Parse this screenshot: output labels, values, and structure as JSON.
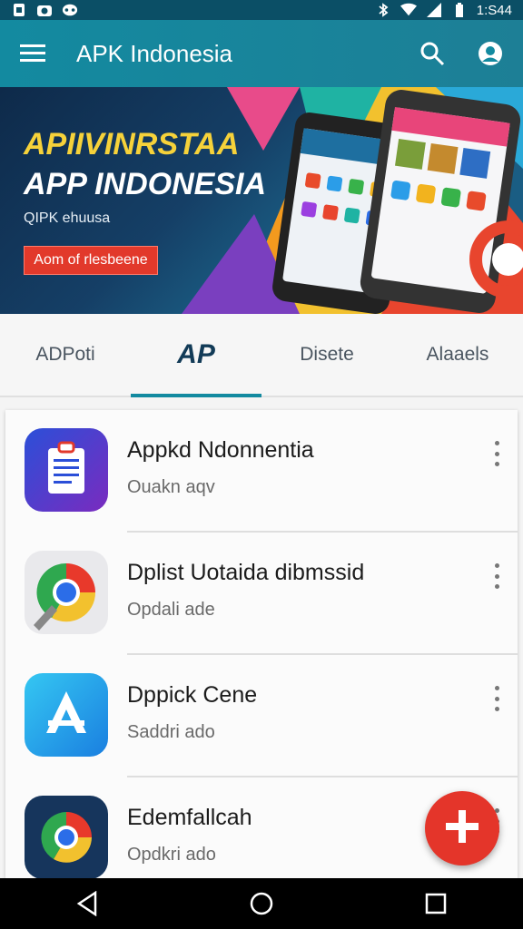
{
  "status_bar": {
    "time": "1:S44",
    "icons": [
      "sim-icon",
      "camera-icon",
      "game-icon",
      "bluetooth-icon",
      "wifi-icon",
      "signal-icon",
      "battery-icon"
    ]
  },
  "app_bar": {
    "title": "APK Indonesia",
    "icons": [
      "menu-icon",
      "search-icon",
      "account-icon"
    ]
  },
  "banner": {
    "headline1": "APIIVINRSTAA",
    "headline2": "APP INDONESIA",
    "subtitle": "QIPK ehuusa",
    "button_label": "Aom of rlesbeene"
  },
  "tabs": [
    {
      "label": "ADPoti"
    },
    {
      "label": "AP",
      "active": true
    },
    {
      "label": "Disete"
    },
    {
      "label": "Alaaels"
    }
  ],
  "apps": [
    {
      "title": "Appkd Ndonnentia",
      "subtitle": "Ouakn aqv",
      "icon": "notes-app-icon"
    },
    {
      "title": "Dplist Uotaida dibmssid",
      "subtitle": "Opdali ade",
      "icon": "chrome-app-icon"
    },
    {
      "title": "Dppick Cene",
      "subtitle": "Saddri ado",
      "icon": "appstore-app-icon"
    },
    {
      "title": "Edemfallcah",
      "subtitle": "Opdkri ado",
      "icon": "chrome-alt-app-icon"
    }
  ],
  "colors": {
    "primary": "#138aa0",
    "accent": "#e4352a",
    "banner_yellow": "#f6d23a"
  },
  "nav": [
    "back-icon",
    "home-icon",
    "recents-icon"
  ]
}
